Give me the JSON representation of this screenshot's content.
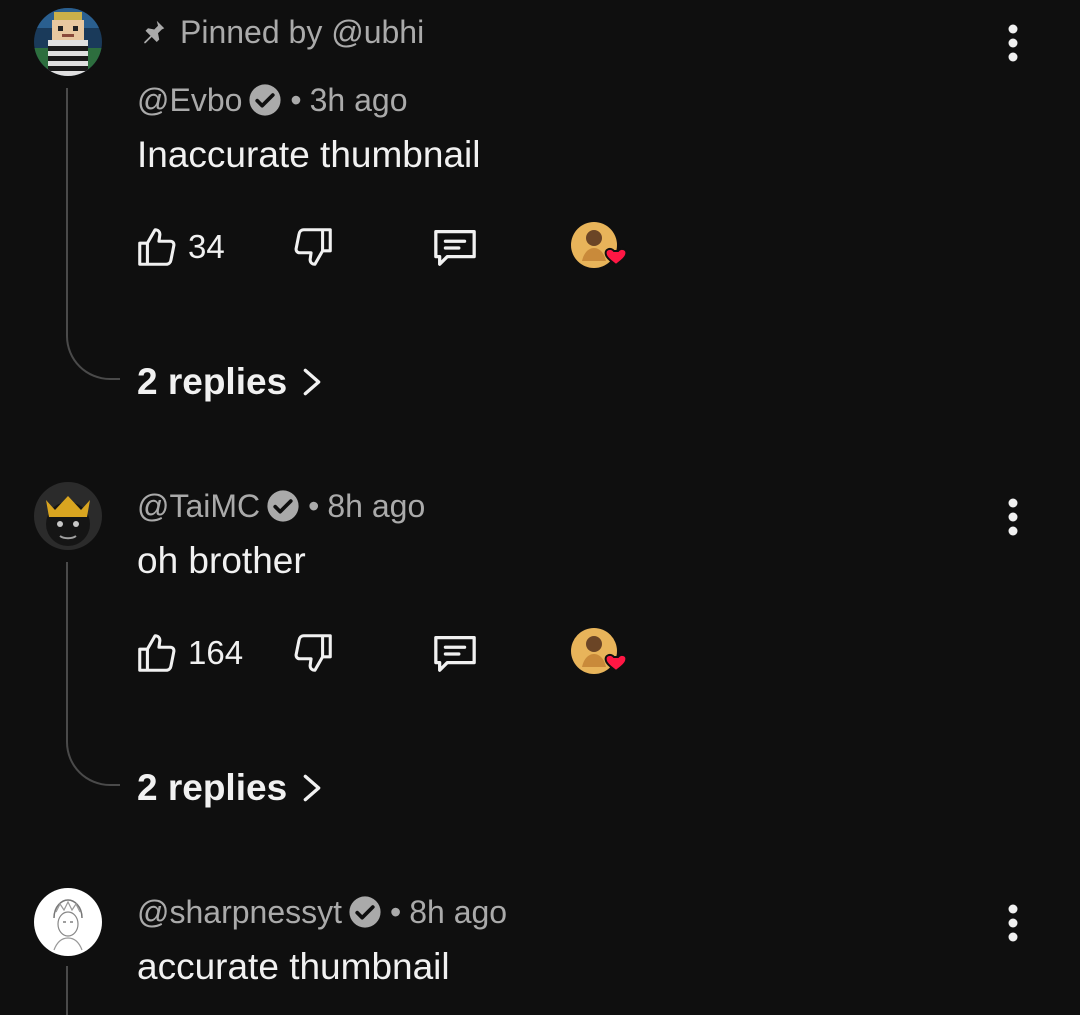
{
  "comments": [
    {
      "pinned_text": "Pinned by @ubhi",
      "author": "@Evbo",
      "separator": "•",
      "time": "3h ago",
      "text": "Inaccurate thumbnail",
      "likes": "34",
      "replies_label": "2 replies",
      "avatar_icon": "pixel-character-avatar"
    },
    {
      "author": "@TaiMC",
      "separator": "•",
      "time": "8h ago",
      "text": "oh brother",
      "likes": "164",
      "replies_label": "2 replies",
      "avatar_icon": "crowned-character-avatar"
    },
    {
      "author": "@sharpnessyt",
      "separator": "•",
      "time": "8h ago",
      "text": "accurate thumbnail",
      "avatar_icon": "sketch-avatar"
    }
  ],
  "colors": {
    "background": "#0f0f0f",
    "text_primary": "#f1f1f1",
    "text_secondary": "#aaaaaa",
    "heart": "#ff1744",
    "thread_line": "#4a4a4a"
  }
}
